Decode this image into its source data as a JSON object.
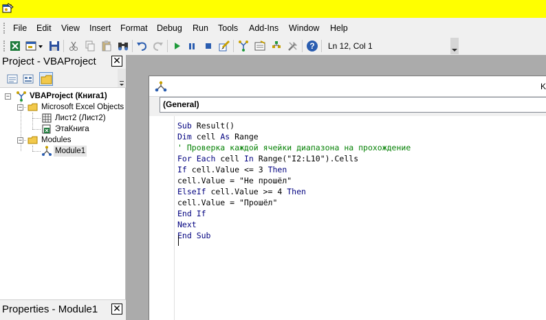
{
  "menu": {
    "file": "File",
    "edit": "Edit",
    "view": "View",
    "insert": "Insert",
    "format": "Format",
    "debug": "Debug",
    "run": "Run",
    "tools": "Tools",
    "addins": "Add-Ins",
    "window": "Window",
    "help": "Help"
  },
  "toolbar": {
    "cursor_position": "Ln 12, Col 1"
  },
  "project_pane": {
    "title": "Project - VBAProject",
    "close_label": "✕",
    "tree": {
      "root": "VBAProject (Книга1)",
      "objects_folder": "Microsoft Excel Objects",
      "sheet": "Лист2 (Лист2)",
      "workbook": "ЭтаКнига",
      "modules_folder": "Modules",
      "module": "Module1"
    }
  },
  "properties_pane": {
    "title": "Properties - Module1",
    "close_label": "✕"
  },
  "code_window": {
    "title_fragment": "K",
    "object_selector": "(General)",
    "lines": [
      [
        {
          "t": "kw",
          "v": "Sub "
        },
        {
          "t": "tx",
          "v": "Result()"
        }
      ],
      [
        {
          "t": "kw",
          "v": "Dim "
        },
        {
          "t": "tx",
          "v": "cell "
        },
        {
          "t": "kw",
          "v": "As "
        },
        {
          "t": "tx",
          "v": "Range"
        }
      ],
      [
        {
          "t": "cm",
          "v": "' Проверка каждой ячейки диапазона на прохождение"
        }
      ],
      [
        {
          "t": "kw",
          "v": "For Each "
        },
        {
          "t": "tx",
          "v": "cell "
        },
        {
          "t": "kw",
          "v": "In "
        },
        {
          "t": "tx",
          "v": "Range(\"I2:L10\").Cells"
        }
      ],
      [
        {
          "t": "kw",
          "v": "If "
        },
        {
          "t": "tx",
          "v": "cell.Value <= 3 "
        },
        {
          "t": "kw",
          "v": "Then"
        }
      ],
      [
        {
          "t": "tx",
          "v": "cell.Value = \"Не прошёл\""
        }
      ],
      [
        {
          "t": "kw",
          "v": "ElseIf "
        },
        {
          "t": "tx",
          "v": "cell.Value >= 4 "
        },
        {
          "t": "kw",
          "v": "Then"
        }
      ],
      [
        {
          "t": "tx",
          "v": "cell.Value = \"Прошёл\""
        }
      ],
      [
        {
          "t": "kw",
          "v": "End If"
        }
      ],
      [
        {
          "t": "kw",
          "v": "Next"
        }
      ],
      [
        {
          "t": "kw",
          "v": "End Sub"
        }
      ]
    ]
  },
  "colors": {
    "title_strip": "#ffff00",
    "chrome": "#f0f0f0",
    "workspace": "#ababab",
    "keyword": "#00007f",
    "comment": "#007f00"
  },
  "icons": [
    "excel-view-icon",
    "insert-userform-icon",
    "save-icon",
    "cut-icon",
    "copy-icon",
    "paste-icon",
    "find-icon",
    "undo-icon",
    "redo-icon",
    "run-icon",
    "break-icon",
    "reset-icon",
    "design-mode-icon",
    "project-explorer-icon",
    "properties-icon",
    "object-browser-icon",
    "toolbox-icon",
    "help-icon"
  ]
}
